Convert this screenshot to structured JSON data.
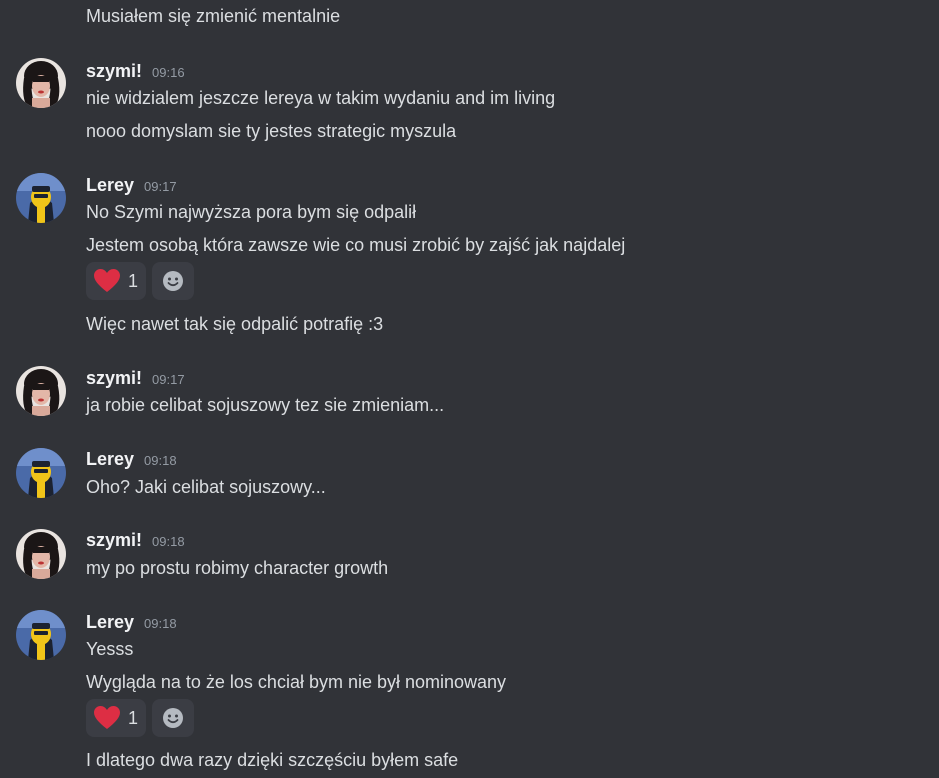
{
  "users": {
    "szymi": "szymi!",
    "lerey": "Lerey"
  },
  "messages": [
    {
      "lines": [
        "Musiałem się zmienić mentalnie"
      ]
    },
    {
      "author": "szymi!",
      "time": "09:16",
      "lines": [
        "nie widzialem jeszcze lereya w takim wydaniu and im living",
        "nooo domyslam sie ty jestes strategic myszula"
      ]
    },
    {
      "author": "Lerey",
      "time": "09:17",
      "lines": [
        "No Szymi najwyższa pora bym się odpalił",
        "Jestem osobą która zawsze wie co musi zrobić by zajść jak najdalej",
        "Więc nawet tak się odpalić potrafię :3"
      ],
      "reaction": {
        "emoji": "heart",
        "count": "1"
      }
    },
    {
      "author": "szymi!",
      "time": "09:17",
      "lines": [
        "ja robie celibat sojuszowy tez sie zmieniam..."
      ]
    },
    {
      "author": "Lerey",
      "time": "09:18",
      "lines": [
        "Oho? Jaki celibat sojuszowy..."
      ]
    },
    {
      "author": "szymi!",
      "time": "09:18",
      "lines": [
        "my po prostu robimy character growth"
      ]
    },
    {
      "author": "Lerey",
      "time": "09:18",
      "lines": [
        "Yesss",
        "Wygląda na to że los chciał bym nie był nominowany",
        "I dlatego dwa razy dzięki szczęściu byłem safe"
      ],
      "reaction": {
        "emoji": "heart",
        "count": "1"
      }
    }
  ],
  "colors": {
    "background": "#313338",
    "text": "#dbdee1",
    "username": "#f2f3f5",
    "timestamp": "#949ba4",
    "reaction_bg": "#3b3d44",
    "heart": "#dd2e44"
  },
  "icons": {
    "heart": "heart-emoji-icon",
    "add_reaction": "add-reaction-smiley-icon"
  }
}
